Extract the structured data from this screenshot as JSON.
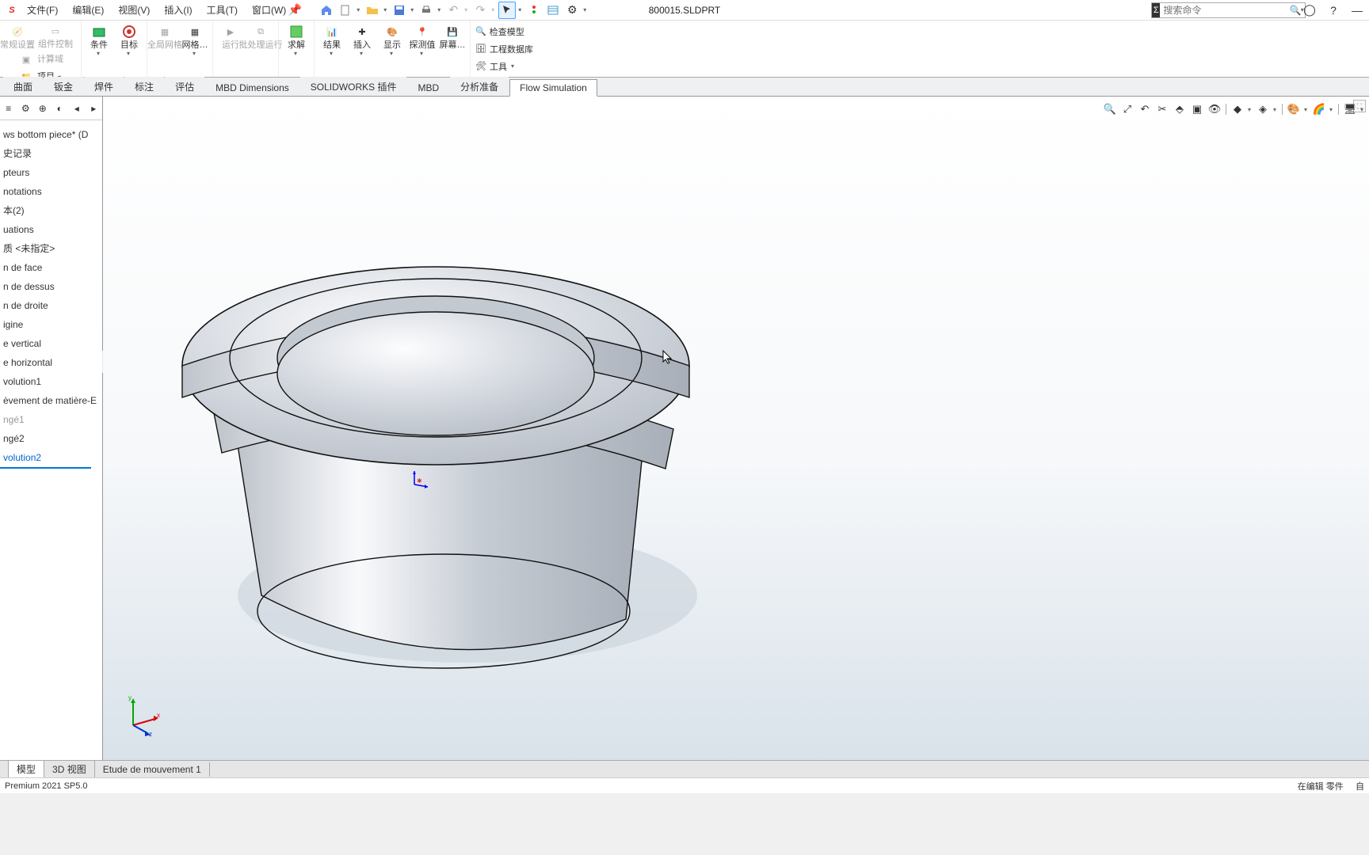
{
  "app": {
    "logo": "S",
    "doc_title": "800015.SLDPRT"
  },
  "menu": {
    "file": "文件(F)",
    "edit": "编辑(E)",
    "view": "视图(V)",
    "insert": "插入(I)",
    "tools": "工具(T)",
    "window": "窗口(W)"
  },
  "search": {
    "placeholder": "搜索命令"
  },
  "ribbon": {
    "g1": {
      "a": "常规设置",
      "b": "组件控制",
      "c": "计算域",
      "d": "项目"
    },
    "g2": {
      "a": "条件",
      "b": "目标"
    },
    "g3": {
      "a": "全局网格",
      "b": "网格…"
    },
    "g4": {
      "a": "运行",
      "b": "批处理运行"
    },
    "g5": {
      "a": "求解"
    },
    "g6": {
      "a": "结果",
      "b": "插入",
      "c": "显示",
      "d": "探测值",
      "e": "屏幕…"
    },
    "g7": {
      "a": "检查模型",
      "b": "工程数据库",
      "c": "工具"
    }
  },
  "tabs": {
    "items": [
      "曲面",
      "钣金",
      "焊件",
      "标注",
      "评估",
      "MBD Dimensions",
      "SOLIDWORKS 插件",
      "MBD",
      "分析准备",
      "Flow Simulation"
    ],
    "active": 9
  },
  "tree": {
    "items": [
      {
        "t": "ws bottom  piece*  (D"
      },
      {
        "t": "史记录"
      },
      {
        "t": "pteurs"
      },
      {
        "t": "notations"
      },
      {
        "t": "本(2)"
      },
      {
        "t": "uations"
      },
      {
        "t": "质 <未指定>"
      },
      {
        "t": "n de face"
      },
      {
        "t": "n de dessus"
      },
      {
        "t": "n de droite"
      },
      {
        "t": "igine"
      },
      {
        "t": "e vertical"
      },
      {
        "t": "e horizontal"
      },
      {
        "t": "volution1"
      },
      {
        "t": "èvement de matière-E"
      },
      {
        "t": "ngé1",
        "gray": true
      },
      {
        "t": "ngé2"
      },
      {
        "t": "volution2",
        "sel": true,
        "last": true
      }
    ]
  },
  "bottom_tabs": {
    "items": [
      "模型",
      "3D 视图",
      "Etude de mouvement 1"
    ],
    "active": 0
  },
  "status": {
    "left": "Premium 2021 SP5.0",
    "right1": "在编辑  零件",
    "right2": "自"
  },
  "triad_labels": {
    "x": "x",
    "y": "y",
    "z": "z"
  }
}
